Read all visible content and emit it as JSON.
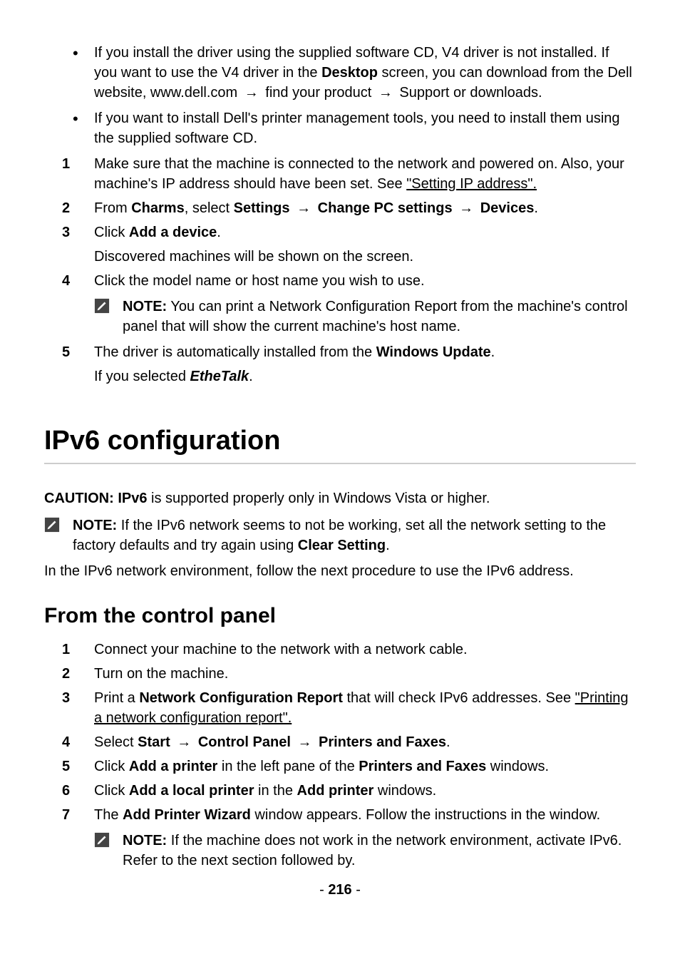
{
  "bullets": {
    "b1_pre": "If you install the driver using the supplied software CD, V4 driver is not installed. If you want to use the V4 driver in the ",
    "b1_bold1": "Desktop",
    "b1_mid": " screen, you can download from the Dell website, www.dell.com ",
    "b1_mid2": " find your product ",
    "b1_end": " Support or downloads.",
    "b2": "If you want to install Dell's printer management tools, you need to install them using the supplied software CD."
  },
  "steps1": {
    "s1_pre": "Make sure that the machine is connected to the network and powered on. Also, your machine's IP address should have been set. See ",
    "s1_link": "\"Setting IP address\".",
    "s2_pre": "From ",
    "s2_b1": "Charms",
    "s2_mid1": ", select ",
    "s2_b2": "Settings",
    "s2_b3": "Change PC settings",
    "s2_b4": "Devices",
    "s2_end": ".",
    "s3_pre": "Click ",
    "s3_b1": "Add a device",
    "s3_end": ".",
    "s3_sub": "Discovered machines will be shown on the screen.",
    "s4": "Click the model name or host name you wish to use.",
    "s4_note_b": "NOTE:",
    "s4_note": " You can print a Network Configuration Report from the machine's control panel that will show the current machine's host name.",
    "s5_pre": "The driver is automatically installed from the ",
    "s5_b1": "Windows Update",
    "s5_end": ".",
    "s5_sub_pre": "If you selected ",
    "s5_sub_bi": "EtheTalk",
    "s5_sub_end": "."
  },
  "section_title": "IPv6 configuration",
  "caution_pre": "CAUTION: IPv6",
  "caution_body": " is supported properly only in Windows Vista or higher.",
  "note2_b": "NOTE:",
  "note2_body_pre": " If the IPv6 network seems to not be working, set all the network setting to the factory defaults and try again using ",
  "note2_body_b": "Clear Setting",
  "note2_body_end": ".",
  "ipv6_intro": "In the IPv6 network environment, follow the next procedure to use the IPv6 address.",
  "subsection": "From the control panel",
  "steps2": {
    "s1": "Connect your machine to the network with a network cable.",
    "s2": "Turn on the machine.",
    "s3_pre": "Print a ",
    "s3_b1": "Network Configuration Report",
    "s3_mid": " that will check IPv6 addresses. See ",
    "s3_link": "\"Printing a network configuration report\".",
    "s4_pre": "Select ",
    "s4_b1": "Start",
    "s4_b2": "Control Panel",
    "s4_b3": "Printers and Faxes",
    "s4_end": ".",
    "s5_pre": "Click ",
    "s5_b1": "Add a printer",
    "s5_mid": " in the left pane of the ",
    "s5_b2": "Printers and Faxes",
    "s5_end": " windows.",
    "s6_pre": "Click ",
    "s6_b1": "Add a local printer",
    "s6_mid": " in the ",
    "s6_b2": "Add  printer",
    "s6_end": " windows.",
    "s7_pre": "The ",
    "s7_b1": "Add Printer Wizard",
    "s7_end": " window appears. Follow the instructions in the window.",
    "s7_note_b": "NOTE:",
    "s7_note": " If the machine does not work in the network environment, activate IPv6. Refer to the next section followed by."
  },
  "nums": {
    "n1": "1",
    "n2": "2",
    "n3": "3",
    "n4": "4",
    "n5": "5",
    "n6": "6",
    "n7": "7"
  },
  "page_number": "216"
}
